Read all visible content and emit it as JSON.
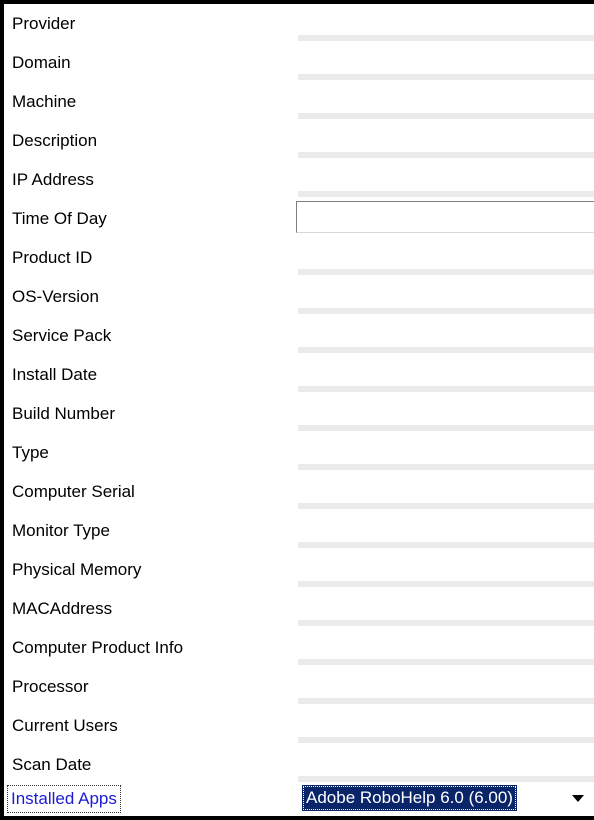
{
  "properties": [
    {
      "label": "Provider",
      "value": ""
    },
    {
      "label": "Domain",
      "value": ""
    },
    {
      "label": "Machine",
      "value": ""
    },
    {
      "label": "Description",
      "value": ""
    },
    {
      "label": "IP Address",
      "value": ""
    },
    {
      "label": "Time Of Day",
      "value": ""
    },
    {
      "label": "Product ID",
      "value": ""
    },
    {
      "label": "OS-Version",
      "value": ""
    },
    {
      "label": "Service Pack",
      "value": ""
    },
    {
      "label": "Install Date",
      "value": ""
    },
    {
      "label": "Build Number",
      "value": ""
    },
    {
      "label": "Type",
      "value": ""
    },
    {
      "label": "Computer Serial",
      "value": ""
    },
    {
      "label": "Monitor Type",
      "value": ""
    },
    {
      "label": "Physical Memory",
      "value": ""
    },
    {
      "label": "MACAddress",
      "value": ""
    },
    {
      "label": "Computer Product Info",
      "value": ""
    },
    {
      "label": "Processor",
      "value": ""
    },
    {
      "label": "Current Users",
      "value": ""
    },
    {
      "label": "Scan Date",
      "value": ""
    },
    {
      "label": "Installed Apps",
      "value": "Adobe RoboHelp 6.0 (6.00)"
    }
  ],
  "icons": {
    "dropdown": "chevron-down-icon"
  },
  "colors": {
    "selected_label": "#1b1bd6",
    "selection_background": "#0a246a",
    "selection_text": "#ffffff",
    "row_separator": "#ebebeb"
  }
}
